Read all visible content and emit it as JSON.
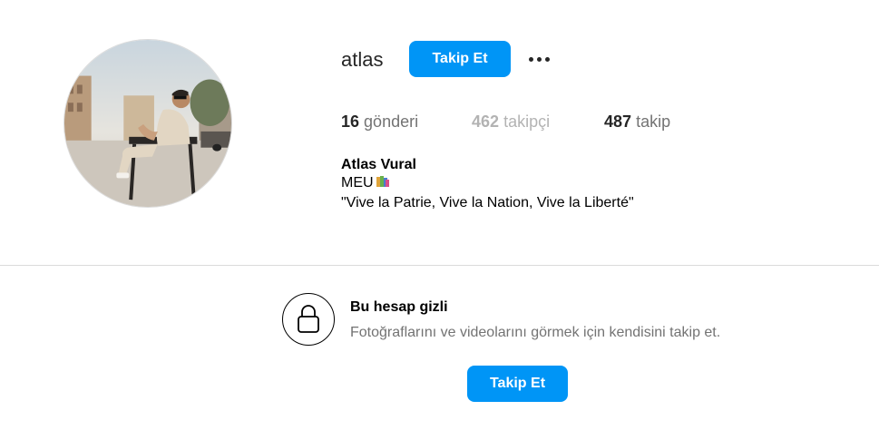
{
  "profile": {
    "username": "atlas",
    "follow_label": "Takip Et",
    "more_icon": "more-horizontal-icon",
    "avatar_icon": "profile-photo",
    "stats": {
      "posts_count": "16",
      "posts_label": "gönderi",
      "followers_count": "462",
      "followers_label": "takipçi",
      "following_count": "487",
      "following_label": "takip"
    },
    "bio": {
      "full_name": "Atlas Vural",
      "line1": "MEU",
      "line1_emoji": "books-emoji",
      "line2": "\"Vive la Patrie, Vive la Nation, Vive la Liberté\""
    }
  },
  "private": {
    "icon": "lock-icon",
    "title": "Bu hesap gizli",
    "description": "Fotoğraflarını ve videolarını görmek için kendisini takip et.",
    "follow_label": "Takip Et"
  },
  "colors": {
    "accent": "#0095f6",
    "text": "#262626",
    "muted": "#737373",
    "divider": "#dbdbdb"
  }
}
